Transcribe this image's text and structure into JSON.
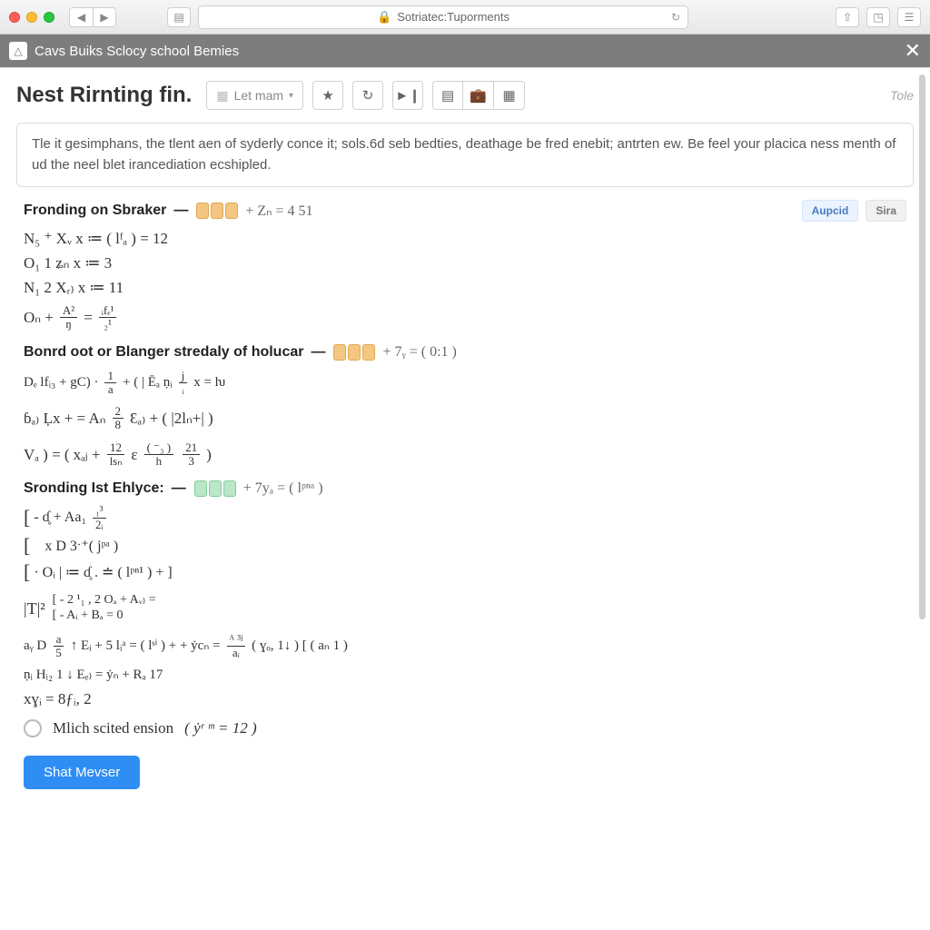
{
  "browser": {
    "url_label": "Sotriatec:Tuporments"
  },
  "tab": {
    "title": "Cavs Buiks Sclocy school Bemies"
  },
  "toolbar": {
    "page_title": "Nest Rirnting fin.",
    "dropdown_label": "Let mam",
    "right_label": "Tole"
  },
  "description": "Tle it gesimphans, the tlent aen of syderly conce it; sols.6d seb bedties, deathage be fred enebit; antrten ew. Be feel your placica ness menth of ud the neel blet irancediation ecshipled.",
  "section1": {
    "title": "Fronding on Sbraker",
    "eq": "+ Zₙ = 4 51",
    "lines": {
      "l1": "N₅ ⁺ Xᵥ x ≔ ( lᶠₐ ) = 12",
      "l2": "O₁ 1  ʑₙ  x ≔  3",
      "l3": "N₁ 2  Xᵣ₎  x ≔ 11"
    },
    "frac": {
      "left_num": "A²",
      "left_den": "ŋ",
      "right_num": "ᵢfₑ¹",
      "right_den": "₂¹"
    },
    "frac_prefix": "Oₙ +"
  },
  "badges": {
    "b1": "Aupcid",
    "b2": "Sira"
  },
  "section2": {
    "title": "Bonrd oot or Blanger stredaly of holucar",
    "eq": "+ 7ᵧ = ( 0:1 )",
    "lines": {
      "l1_a": "Dₑ lfᵢ₃ + gC) ·",
      "l1_b": "+ ( | Ēₐ  ṇᵢ",
      "l1_c": "x =  ƕ",
      "l2_a": "ɓₐ₎  Ļx  + = Aₙ",
      "l2_b": "Ɛₐ₎ + ( |2lₙ+| )",
      "l3_a": "Vₐ ) = (",
      "l3_b": "xₐⱼ +",
      "l3_c": ")"
    },
    "f1": {
      "num": "1",
      "den": "a"
    },
    "f1b": {
      "num": "j",
      "den": "ᵢ"
    },
    "f2": {
      "num": "2",
      "den": "8"
    },
    "f3": {
      "num": "12",
      "den": "lsₙ"
    },
    "f4": {
      "num": "( ⁻₃ )",
      "den": "h"
    },
    "f5": {
      "num": "21",
      "den": "3"
    }
  },
  "section3": {
    "title": "Sronding Ist Ehlyce:",
    "eq": "+ 7yₐ = ( lᵖⁿᵃ )",
    "br": {
      "r1": "- ɗ̥  + Aa₁",
      "r2": "  x D 3ˑ⁺( jᵖᵃ )",
      "r3": "· Oᵢ | ≔ ɗ̥ . ≐ ( lᵖⁿ¹ ) + ]",
      "r4l": "- 2 ¹₁ , 2 Oₐ + Aᵥ₎  =",
      "r4r": "- Aᵢ  + Bₐ  =  0"
    },
    "f_br1": {
      "num": "₁³",
      "den": "2ᵢ"
    },
    "lines": {
      "l1_a": "aᵧ  D",
      "l1_b": "↑ Eᵢ + 5 lᵢᵃ = ( lˢⁱ ) +  + ẏcₙ =",
      "l1_c": "( ɣₒ, 1↓ )  [ ( aₙ 1 )",
      "l2": "ṇᵢ  Hᵢ₂  1 ↓  Eₑ₎  = ẏₙ  + Rₐ 17",
      "l3": "xɣᵢ = 8ƒᵢ, 2"
    },
    "f_g1": {
      "num": "a",
      "den": "5"
    },
    "f_g2": {
      "num": "ᴬ ³ʲ",
      "den": "aᵢ"
    }
  },
  "radio": {
    "label": "Mlich scited ension",
    "expr": "( ẏʳ ᵐ = 12 )"
  },
  "submit": "Shat Mevser"
}
